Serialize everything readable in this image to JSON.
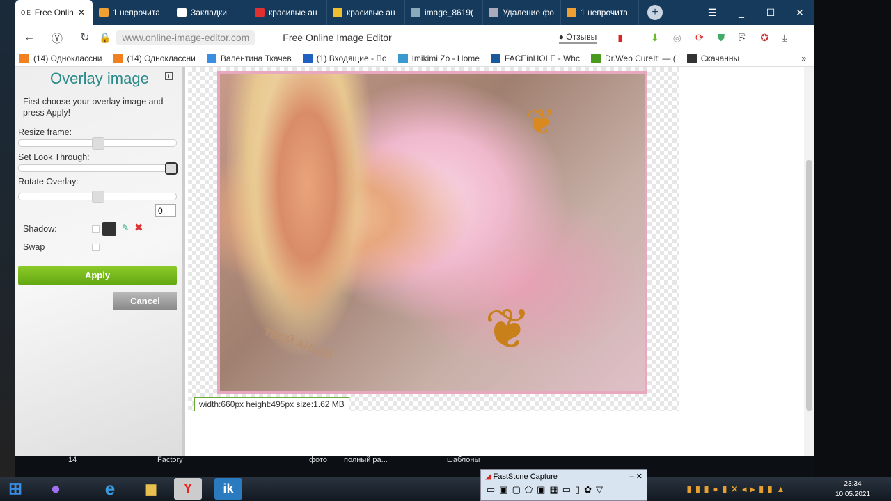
{
  "browser": {
    "tabs": [
      {
        "label": "Free Onlin",
        "favicon": "OIE",
        "active": true
      },
      {
        "label": "1 непрочита",
        "color": "#f0a030"
      },
      {
        "label": "Закладки",
        "color": "#fff"
      },
      {
        "label": "красивые ан",
        "color": "#e03030"
      },
      {
        "label": "красивые ан",
        "color": "#f0c030"
      },
      {
        "label": "image_8619(",
        "color": "#8ab"
      },
      {
        "label": "Удаление фо",
        "color": "#aab"
      },
      {
        "label": "1 непрочита",
        "color": "#f0a030"
      }
    ],
    "url": "www.online-image-editor.com",
    "page_title": "Free Online Image Editor",
    "reviews_label": "Отзывы",
    "bookmarks": [
      {
        "label": "(14) Одноклассни",
        "color": "#f08020"
      },
      {
        "label": "(14) Одноклассни",
        "color": "#f08020"
      },
      {
        "label": "Валентина Ткачев",
        "color": "#3a8de0"
      },
      {
        "label": "(1) Входящие - По",
        "color": "#2060c0"
      },
      {
        "label": "Imikimi Zo - Home",
        "color": "#3a9ad0"
      },
      {
        "label": "FACEinHOLE - Whc",
        "color": "#1a5a9a"
      },
      {
        "label": "Dr.Web CureIt! — (",
        "color": "#4a9a20"
      },
      {
        "label": "Скачанны",
        "color": "#333"
      }
    ]
  },
  "panel": {
    "title": "Overlay image",
    "instructions": "First choose your overlay image and press Apply!",
    "resize_label": "Resize frame:",
    "resize_value": 0.5,
    "look_through_label": "Set Look Through:",
    "look_through_value": 1.0,
    "rotate_label": "Rotate Overlay:",
    "rotate_value": "0",
    "shadow_label": "Shadow:",
    "swap_label": "Swap",
    "apply_label": "Apply",
    "cancel_label": "Cancel"
  },
  "image_info": "width:660px  height:495px  size:1.62 MB",
  "image_text": "ТВОЙ АНГЕЛ",
  "desktop_labels": [
    "14",
    "Factory",
    "фото",
    "полный ра...",
    "шаблоны"
  ],
  "faststone": {
    "title": "FastStone Capture"
  },
  "clock": {
    "time": "23:34",
    "date": "10.05.2021"
  }
}
